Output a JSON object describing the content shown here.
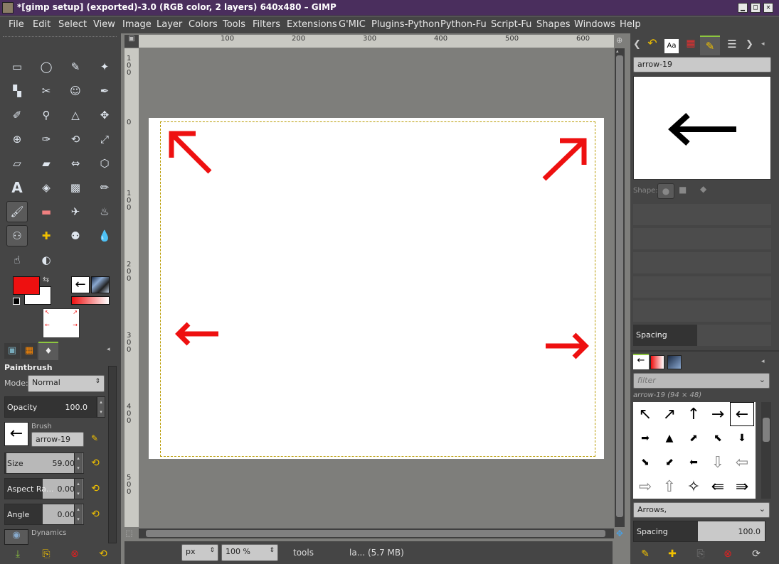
{
  "window": {
    "title": "*[gimp setup] (exported)-3.0 (RGB color, 2 layers) 640x480 – GIMP",
    "buttons": {
      "minimize": "▁",
      "maximize": "□",
      "close": "✕"
    }
  },
  "menu": [
    "File",
    "Edit",
    "Select",
    "View",
    "Image",
    "Layer",
    "Colors",
    "Tools",
    "Filters",
    "Extensions",
    "G'MIC",
    "Plugins-Python",
    "Python-Fu",
    "Script-Fu",
    "Shapes",
    "Windows",
    "Help"
  ],
  "toolbox": {
    "tools": [
      [
        "rect-select-icon",
        "ellipse-select-icon",
        "free-select-icon",
        "fuzzy-select-icon"
      ],
      [
        "color-select-icon",
        "scissors-icon",
        "foreground-select-icon",
        "paths-icon"
      ],
      [
        "color-picker-icon",
        "zoom-icon",
        "measure-icon",
        "move-icon"
      ],
      [
        "align-icon",
        "crop-icon",
        "unified-transform-icon",
        "scale-icon"
      ],
      [
        "perspective-icon",
        "shear-icon",
        "flip-icon",
        "cage-transform-icon"
      ],
      [
        "text-icon",
        "bucket-fill-icon",
        "gradient-icon",
        "pencil-icon"
      ],
      [
        "paintbrush-icon",
        "eraser-icon",
        "airbrush-icon",
        "ink-icon"
      ],
      [
        "clone-icon",
        "heal-icon",
        "perspective-clone-icon",
        "blur-icon"
      ],
      [
        "smudge-icon",
        "dodge-burn-icon"
      ]
    ],
    "fg_color": "#ee1010",
    "bg_color": "#ffffff"
  },
  "tool_options": {
    "title": "Paintbrush",
    "mode_label": "Mode:",
    "mode_value": "Normal",
    "opacity_label": "Opacity",
    "opacity_value": "100.0",
    "brush_label": "Brush",
    "brush_value": "arrow-19",
    "size_label": "Size",
    "size_value": "59.00",
    "aspect_label": "Aspect Ra...",
    "aspect_value": "0.00",
    "angle_label": "Angle",
    "angle_value": "0.00",
    "dynamics_label": "Dynamics"
  },
  "rulers": {
    "top": [
      "100",
      "200",
      "300",
      "400",
      "500",
      "600"
    ],
    "left": [
      [
        "1",
        "0",
        "0"
      ],
      [
        "0"
      ],
      [
        "1",
        "0",
        "0"
      ],
      [
        "2",
        "0",
        "0"
      ],
      [
        "3",
        "0",
        "0"
      ],
      [
        "4",
        "0",
        "0"
      ],
      [
        "5",
        "0",
        "0"
      ]
    ]
  },
  "canvas": {
    "arrows": [
      "↖",
      "↗",
      "←",
      "→"
    ],
    "arrow_color": "#ee1010"
  },
  "status": {
    "unit": "px",
    "zoom": "100 %",
    "tools_text": "tools",
    "info": "la... (5.7 MB)"
  },
  "brush_dock": {
    "name": "arrow-19",
    "shape_label": "Shape:",
    "spacing_label": "Spacing",
    "filter_placeholder": "filter",
    "grid_caption": "arrow-19 (94 × 48)",
    "grid": [
      "↖",
      "↗",
      "↑",
      "→",
      "←",
      "➡",
      "▲",
      "⬈",
      "⬉",
      "⬇",
      "⬊",
      "⬋",
      "⬅",
      "⇩",
      "⇦",
      "⇨",
      "⇧",
      "✧",
      "⇚",
      "⇛"
    ],
    "tag_value": "Arrows,",
    "bottom_spacing_label": "Spacing",
    "bottom_spacing_value": "100.0"
  }
}
